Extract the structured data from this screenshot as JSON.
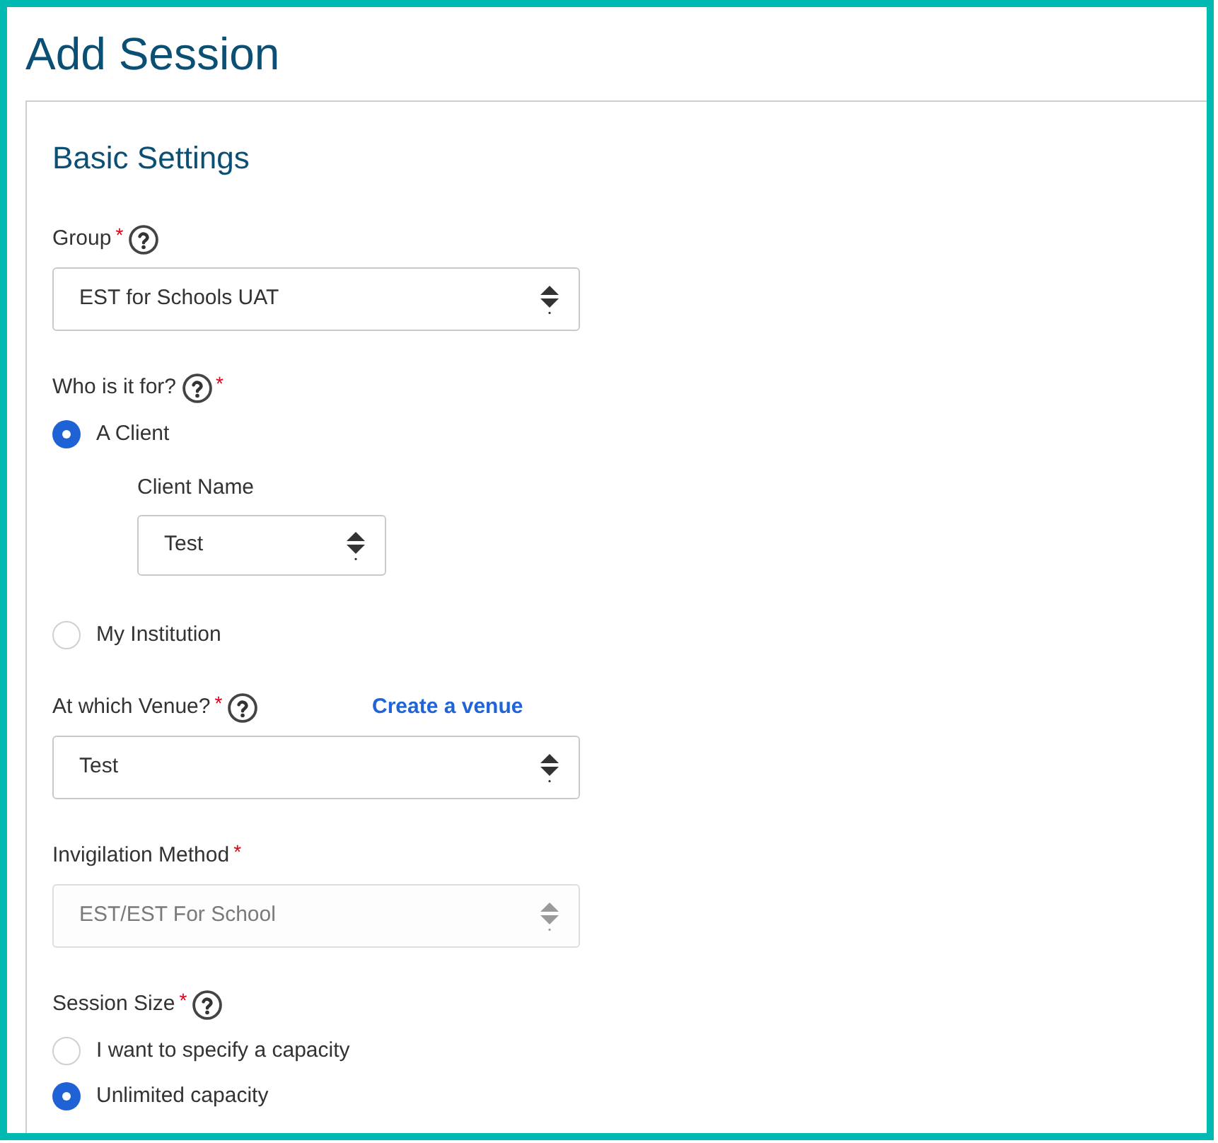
{
  "title": "Add Session",
  "section": {
    "title": "Basic Settings",
    "fields": [
      {
        "kind": "select",
        "label": [
          {
            "kind": "text",
            "text": "Group"
          },
          {
            "kind": "mark",
            "text": "*"
          },
          {
            "kind": "help"
          }
        ],
        "value": "EST for Schools UAT",
        "disabled": false
      },
      {
        "kind": "radio_group",
        "label": [
          {
            "kind": "text",
            "text": "Who is it for?"
          },
          {
            "kind": "help"
          },
          {
            "kind": "mark",
            "text": "*"
          }
        ],
        "options": [
          {
            "label": "A Client",
            "selected": true,
            "subfield": {
              "label": "Client Name",
              "value": "Test",
              "disabled": false
            }
          },
          {
            "label": "My Institution",
            "selected": false
          }
        ]
      },
      {
        "kind": "select",
        "label": [
          {
            "kind": "text",
            "text": "At which Venue?"
          },
          {
            "kind": "mark",
            "text": "*"
          },
          {
            "kind": "help"
          }
        ],
        "link": "Create a venue",
        "value": "Test",
        "disabled": false
      },
      {
        "kind": "select",
        "label": [
          {
            "kind": "text",
            "text": "Invigilation Method"
          },
          {
            "kind": "mark",
            "text": "*"
          }
        ],
        "value": "EST/EST For School",
        "disabled": true
      },
      {
        "kind": "radio_group",
        "label": [
          {
            "kind": "text",
            "text": "Session Size"
          },
          {
            "kind": "mark",
            "text": "*"
          },
          {
            "kind": "help"
          }
        ],
        "options": [
          {
            "label": "I want to specify a capacity",
            "selected": false
          },
          {
            "label": "Unlimited capacity",
            "selected": true
          }
        ]
      }
    ]
  }
}
